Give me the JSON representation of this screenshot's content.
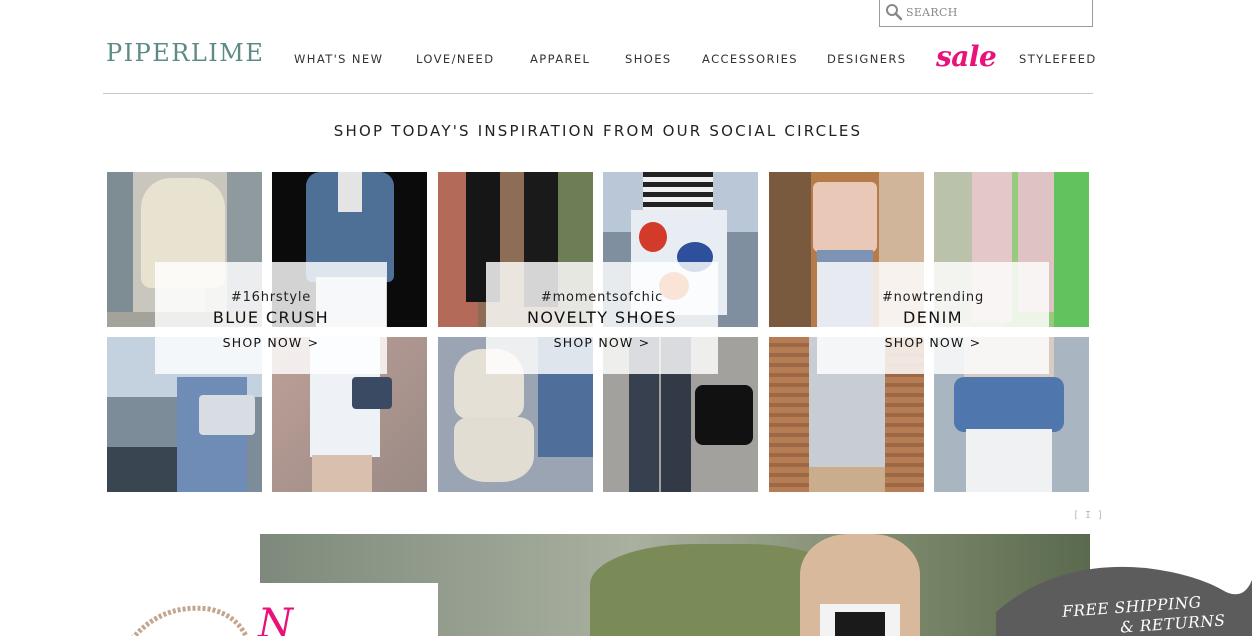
{
  "search": {
    "placeholder": "SEARCH"
  },
  "brand": {
    "logo": "PIPERLIME",
    "accent": "#5d8b86",
    "sale_color": "#e8127a"
  },
  "nav": {
    "items": [
      {
        "label": "WHAT'S NEW"
      },
      {
        "label": "LOVE/NEED"
      },
      {
        "label": "APPAREL"
      },
      {
        "label": "SHOES"
      },
      {
        "label": "ACCESSORIES"
      },
      {
        "label": "DESIGNERS"
      },
      {
        "label": "sale"
      },
      {
        "label": "STYLEFEED"
      }
    ]
  },
  "inspiration": {
    "title": "SHOP TODAY'S INSPIRATION FROM OUR SOCIAL CIRCLES",
    "collections": [
      {
        "hashtag": "#16hrstyle",
        "name": "BLUE CRUSH",
        "cta": "SHOP NOW >"
      },
      {
        "hashtag": "#momentsofchic",
        "name": "NOVELTY SHOES",
        "cta": "SHOP NOW >"
      },
      {
        "hashtag": "#nowtrending",
        "name": "DENIM",
        "cta": "SHOP NOW >"
      }
    ],
    "credit": "[ I ]"
  },
  "promo": {
    "shipping_line1": "FREE SHIPPING",
    "shipping_line2": "& RETURNS",
    "script_text": "N"
  }
}
